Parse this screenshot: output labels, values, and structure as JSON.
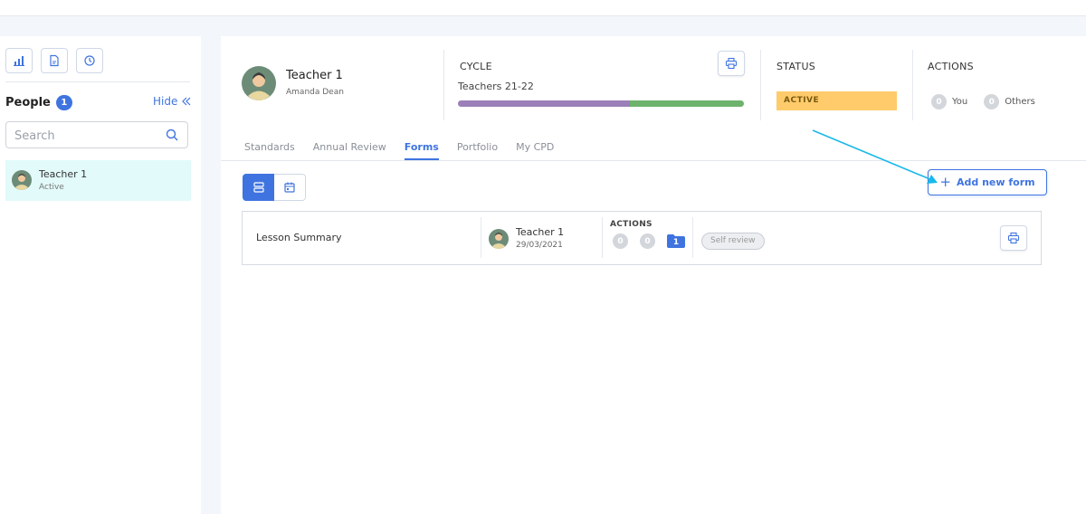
{
  "sidebar": {
    "icons": [
      "bar-chart-icon",
      "document-icon",
      "clock-icon"
    ],
    "people_label": "People",
    "people_count": "1",
    "hide_label": "Hide",
    "hide_icon": "double-chevron-left-icon",
    "search": {
      "placeholder": "Search",
      "value": ""
    },
    "people": [
      {
        "name": "Teacher 1",
        "status": "Active"
      }
    ]
  },
  "profile": {
    "name": "Teacher 1",
    "subtitle": "Amanda Dean"
  },
  "cycle": {
    "label": "CYCLE",
    "name": "Teachers 21-22",
    "progress_fraction": 0.6,
    "colors": [
      "#9b7fb8",
      "#6db36d"
    ]
  },
  "status": {
    "label": "STATUS",
    "value": "ACTIVE",
    "color": "#ffcb6b"
  },
  "actions": {
    "label": "ACTIONS",
    "you_count": "0",
    "you_label": "You",
    "others_count": "0",
    "others_label": "Others"
  },
  "tabs": [
    {
      "label": "Standards",
      "active": false
    },
    {
      "label": "Annual Review",
      "active": false
    },
    {
      "label": "Forms",
      "active": true
    },
    {
      "label": "Portfolio",
      "active": false
    },
    {
      "label": "My CPD",
      "active": false
    }
  ],
  "view_toggle": [
    "list-view-icon",
    "calendar-icon"
  ],
  "add_form_label": "Add new form",
  "forms": [
    {
      "title": "Lesson Summary",
      "teacher": "Teacher 1",
      "date": "29/03/2021",
      "actions_label": "ACTIONS",
      "count_a": "0",
      "count_b": "0",
      "folder_count": "1",
      "tag": "Self review"
    }
  ],
  "accent_color": "#3f74e0"
}
